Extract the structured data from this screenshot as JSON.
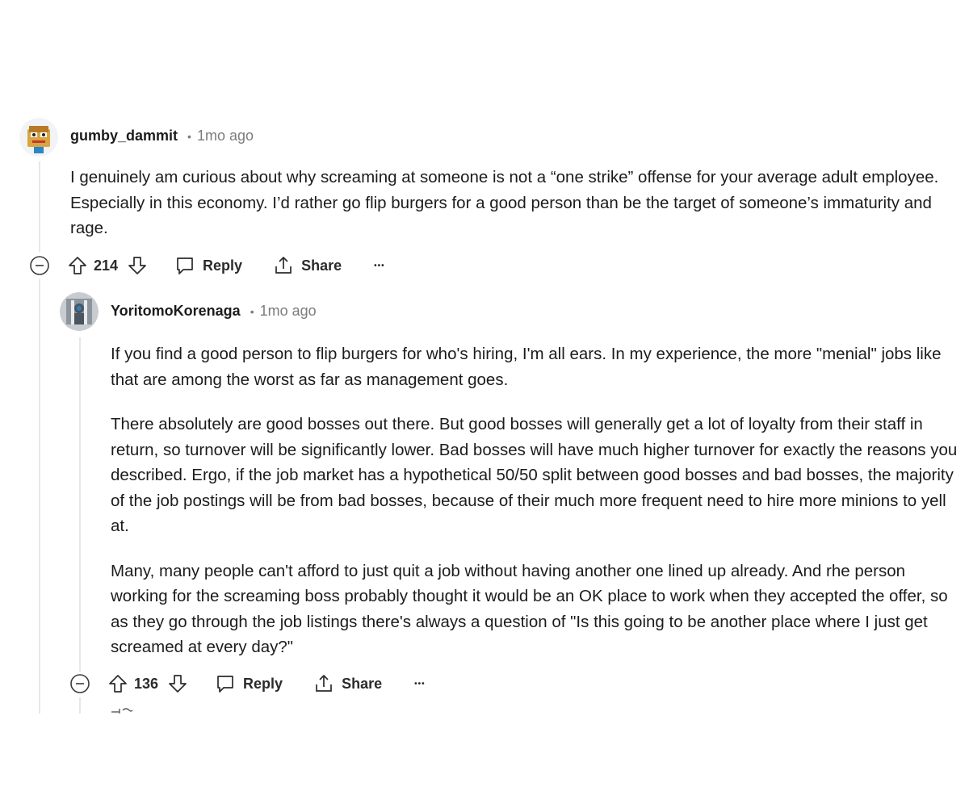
{
  "comments": [
    {
      "username": "gumby_dammit",
      "separator": "•",
      "time": "1mo ago",
      "paragraphs": [
        "I genuinely am curious about why screaming at someone is not a “one strike” offense for your average adult employee. Especially in this economy. I’d rather go flip burgers for a good person than be the target of someone’s immaturity and rage."
      ],
      "score": "214",
      "reply_label": "Reply",
      "share_label": "Share",
      "more_label": "•••"
    },
    {
      "username": "YoritomoKorenaga",
      "separator": "•",
      "time": "1mo ago",
      "paragraphs": [
        "If you find a good person to flip burgers for who's hiring, I'm all ears. In my experience, the more \"menial\" jobs like that are among the worst as far as management goes.",
        "There absolutely are good bosses out there. But good bosses will generally get a lot of loyalty from their staff in return, so turnover will be significantly lower. Bad bosses will have much higher turnover for exactly the reasons you described. Ergo, if the job market has a hypothetical 50/50 split between good bosses and bad bosses, the majority of the job postings will be from bad bosses, because of their much more frequent need to hire more minions to yell at.",
        "Many, many people can't afford to just quit a job without having another one lined up already. And rhe person working for the screaming boss probably thought it would be an OK place to work when they accepted the offer, so as they go through the job listings there's always a question of \"Is this going to be another place where I just get screamed at every day?\""
      ],
      "score": "136",
      "reply_label": "Reply",
      "share_label": "Share",
      "more_label": "•••"
    }
  ],
  "icons": {
    "collapse": "minus-circle-icon",
    "upvote": "arrow-up-icon",
    "downvote": "arrow-down-icon",
    "reply": "comment-bubble-icon",
    "share": "share-upload-icon",
    "more": "ellipsis-icon"
  },
  "colors": {
    "text": "#1c1c1c",
    "meta": "#7c7c7c",
    "thread_line": "#e5e7e9"
  }
}
